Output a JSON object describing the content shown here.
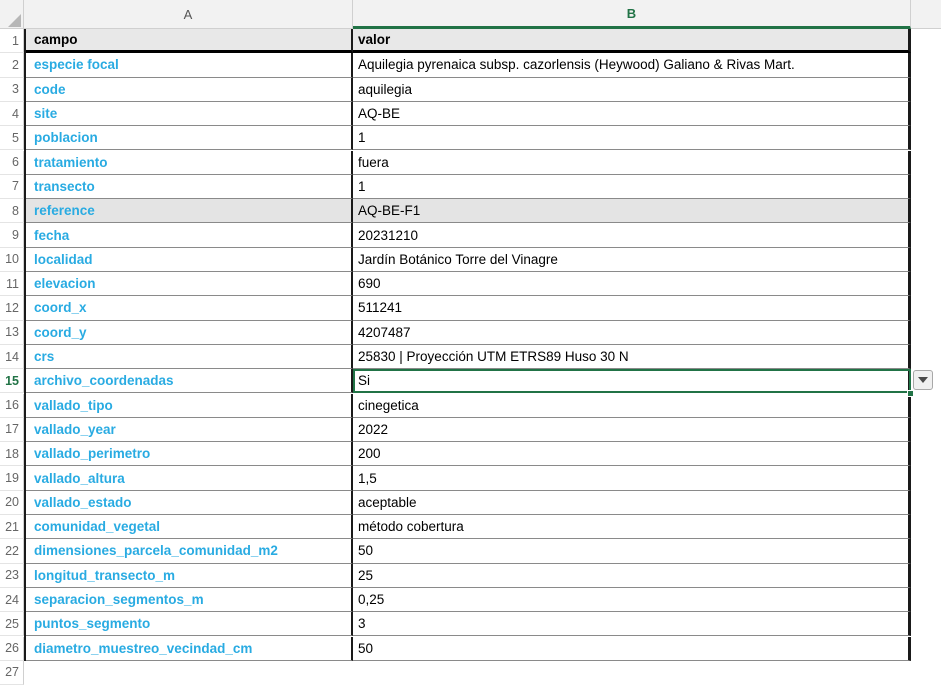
{
  "grid": {
    "columns": [
      {
        "letter": "A",
        "active": false
      },
      {
        "letter": "B",
        "active": true
      }
    ],
    "header_row_number": "1",
    "header_cells": {
      "a": "campo",
      "b": "valor"
    },
    "rows": [
      {
        "num": "2",
        "campo": "especie focal",
        "valor": "Aquilegia pyrenaica subsp. cazorlensis (Heywood) Galiano & Rivas Mart."
      },
      {
        "num": "3",
        "campo": "code",
        "valor": "aquilegia"
      },
      {
        "num": "4",
        "campo": "site",
        "valor": "AQ-BE"
      },
      {
        "num": "5",
        "campo": "poblacion",
        "valor": "1"
      },
      {
        "num": "6",
        "campo": "tratamiento",
        "valor": "fuera"
      },
      {
        "num": "7",
        "campo": "transecto",
        "valor": "1"
      },
      {
        "num": "8",
        "campo": "reference",
        "valor": "AQ-BE-F1"
      },
      {
        "num": "9",
        "campo": "fecha",
        "valor": "20231210"
      },
      {
        "num": "10",
        "campo": "localidad",
        "valor": "Jardín Botánico Torre del Vinagre"
      },
      {
        "num": "11",
        "campo": "elevacion",
        "valor": "690"
      },
      {
        "num": "12",
        "campo": "coord_x",
        "valor": "511241"
      },
      {
        "num": "13",
        "campo": "coord_y",
        "valor": "4207487"
      },
      {
        "num": "14",
        "campo": "crs",
        "valor": "25830 | Proyección UTM ETRS89 Huso 30 N"
      },
      {
        "num": "15",
        "campo": "archivo_coordenadas",
        "valor": "Si"
      },
      {
        "num": "16",
        "campo": "vallado_tipo",
        "valor": "cinegetica"
      },
      {
        "num": "17",
        "campo": "vallado_year",
        "valor": "2022"
      },
      {
        "num": "18",
        "campo": "vallado_perimetro",
        "valor": "200"
      },
      {
        "num": "19",
        "campo": "vallado_altura",
        "valor": "1,5"
      },
      {
        "num": "20",
        "campo": "vallado_estado",
        "valor": "aceptable"
      },
      {
        "num": "21",
        "campo": "comunidad_vegetal",
        "valor": "método cobertura"
      },
      {
        "num": "22",
        "campo": "dimensiones_parcela_comunidad_m2",
        "valor": "50"
      },
      {
        "num": "23",
        "campo": "longitud_transecto_m",
        "valor": "25"
      },
      {
        "num": "24",
        "campo": "separacion_segmentos_m",
        "valor": "0,25"
      },
      {
        "num": "25",
        "campo": "puntos_segmento",
        "valor": "3"
      },
      {
        "num": "26",
        "campo": "diametro_muestreo_vecindad_cm",
        "valor": "50"
      },
      {
        "num": "27",
        "campo": "",
        "valor": ""
      }
    ],
    "shaded_row_number": "8",
    "selected_cell": "B15",
    "selected_row_number": "15",
    "dropdown_icon": "chevron-down-icon",
    "colors": {
      "field_label": "#29abe2",
      "accent_green": "#217346",
      "header_fill": "#e8e8e8",
      "shaded_fill": "#e4e4e4"
    }
  }
}
